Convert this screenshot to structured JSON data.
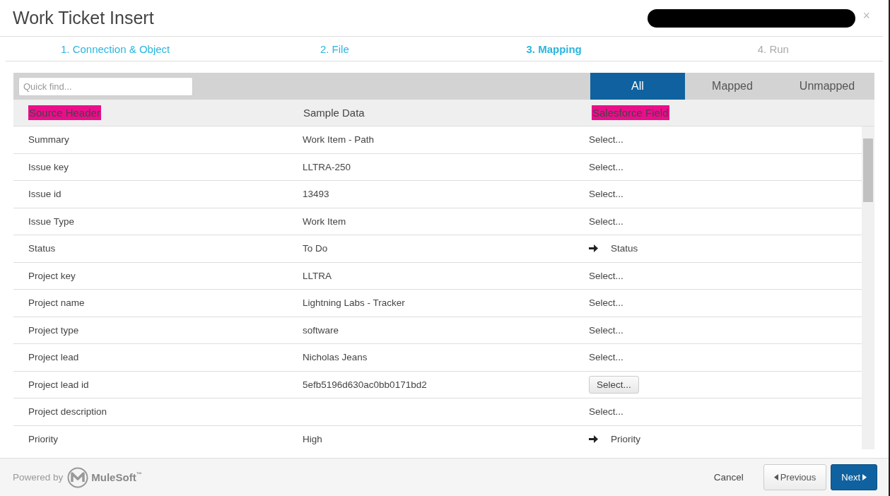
{
  "window": {
    "title": "Work Ticket Insert",
    "close": "×"
  },
  "steps": [
    {
      "label": "1. Connection & Object",
      "selected": false,
      "disabled": false
    },
    {
      "label": "2. File",
      "selected": false,
      "disabled": false
    },
    {
      "label": "3. Mapping",
      "selected": true,
      "disabled": false
    },
    {
      "label": "4. Run",
      "selected": false,
      "disabled": true
    }
  ],
  "search": {
    "placeholder": "Quick find..."
  },
  "filters": [
    {
      "label": "All",
      "selected": true
    },
    {
      "label": "Mapped",
      "selected": false
    },
    {
      "label": "Unmapped",
      "selected": false
    }
  ],
  "columns": [
    {
      "label": "Source Header",
      "highlighted": true
    },
    {
      "label": "Sample Data",
      "highlighted": false
    },
    {
      "label": "Salesforce Field",
      "highlighted": true
    }
  ],
  "rows": [
    {
      "source": "Summary",
      "sample": "Work Item - Path",
      "mapping": {
        "kind": "select",
        "text": "Select..."
      }
    },
    {
      "source": "Issue key",
      "sample": "LLTRA-250",
      "mapping": {
        "kind": "select",
        "text": "Select..."
      }
    },
    {
      "source": "Issue id",
      "sample": "13493",
      "mapping": {
        "kind": "select",
        "text": "Select..."
      }
    },
    {
      "source": "Issue Type",
      "sample": "Work Item",
      "mapping": {
        "kind": "select",
        "text": "Select..."
      }
    },
    {
      "source": "Status",
      "sample": "To Do",
      "mapping": {
        "kind": "mapped",
        "text": "Status"
      }
    },
    {
      "source": "Project key",
      "sample": "LLTRA",
      "mapping": {
        "kind": "select",
        "text": "Select..."
      }
    },
    {
      "source": "Project name",
      "sample": "Lightning Labs - Tracker",
      "mapping": {
        "kind": "select",
        "text": "Select..."
      }
    },
    {
      "source": "Project type",
      "sample": "software",
      "mapping": {
        "kind": "select",
        "text": "Select..."
      }
    },
    {
      "source": "Project lead",
      "sample": "Nicholas Jeans",
      "mapping": {
        "kind": "select",
        "text": "Select..."
      }
    },
    {
      "source": "Project lead id",
      "sample": "5efb5196d630ac0bb0171bd2",
      "mapping": {
        "kind": "button",
        "text": "Select..."
      }
    },
    {
      "source": "Project description",
      "mapping": {
        "kind": "select",
        "text": "Select..."
      }
    },
    {
      "source": "Priority",
      "sample": "High",
      "mapping": {
        "kind": "mapped",
        "text": "Priority"
      }
    }
  ],
  "footer": {
    "powered_by": "Powered by",
    "brand": "MuleSoft",
    "trademark": "™",
    "buttons": [
      {
        "label": "Cancel",
        "kind": "link"
      },
      {
        "label": "Previous",
        "kind": "previous"
      },
      {
        "label": "Next",
        "kind": "next"
      }
    ]
  }
}
